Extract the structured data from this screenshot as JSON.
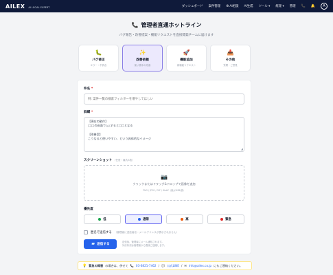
{
  "brand": {
    "name": "AILEX",
    "sub": "AI LEGAL EXPERT"
  },
  "nav": [
    {
      "label": "ダッシュボード",
      "name": "nav-dashboard",
      "icon": ""
    },
    {
      "label": "案件管理",
      "name": "nav-cases",
      "icon": ""
    },
    {
      "label": "AI相談",
      "name": "nav-ai-consult",
      "icon": "⊕"
    },
    {
      "label": "AI生成",
      "name": "nav-ai-generate",
      "icon": ""
    },
    {
      "label": "ツール ▾",
      "name": "nav-tools",
      "icon": ""
    },
    {
      "label": "経理 ▾",
      "name": "nav-accounting",
      "icon": ""
    },
    {
      "label": "管理",
      "name": "nav-admin",
      "icon": ""
    }
  ],
  "user_initial": "A",
  "page": {
    "title": "管理者直通ホットライン",
    "subtitle": "バグ報告・改善提案・機能リクエストを直接開発チームに届けます"
  },
  "categories": [
    {
      "label": "バグ修正",
      "desc": "エラー・不具合",
      "icon": "🐛",
      "name": "category-bug"
    },
    {
      "label": "改善依頼",
      "desc": "使い勝手の改善",
      "icon": "✨",
      "name": "category-improvement"
    },
    {
      "label": "機能追加",
      "desc": "新機能リクエスト",
      "icon": "🚀",
      "name": "category-feature"
    },
    {
      "label": "その他",
      "desc": "質問・ご意見",
      "icon": "📥",
      "name": "category-other"
    }
  ],
  "form": {
    "subject_label": "件名",
    "subject_placeholder": "例: 案件一覧の検索フィルターを増やしてほしい",
    "detail_label": "詳細",
    "detail_lines": [
      "【現在の動作】",
      "◯◯の画面で△△すると□□となる",
      "",
      "【改善案】",
      "こうなると使いやすい、という具体的なイメージ"
    ],
    "screenshot_label": "スクリーンショット",
    "screenshot_hint": "（任意・最大3枚）",
    "dropzone_text": "クリックまたはドラッグ&ドロップで画像を追加",
    "dropzone_hint": "PNG / JPEG / GIF / WebP（最大5MB/枚）",
    "priority_label": "優先度",
    "priorities": [
      {
        "label": "低",
        "color": "#16a34a",
        "name": "priority-low"
      },
      {
        "label": "通常",
        "color": "#2563eb",
        "name": "priority-normal"
      },
      {
        "label": "高",
        "color": "#ea580c",
        "name": "priority-high"
      },
      {
        "label": "緊急",
        "color": "#dc2626",
        "name": "priority-urgent"
      }
    ],
    "anonymous_label": "匿名で送信する",
    "anonymous_hint": "（管理者に送信者名・メールアドレスが表示されません）",
    "submit_label": "送信する",
    "submit_note_1": "送信後、管理者にメール通知されます。",
    "submit_note_2": "対応状況は管理者から直接ご連絡します。"
  },
  "footer": {
    "prefix": "緊急の障害",
    "text1": "の場合は、併せて",
    "phone": "03-6821-7462",
    "sep": "/",
    "line": "公式LINE",
    "mail": "info@ailex.co.jp",
    "text2": "にもご連絡ください。"
  }
}
